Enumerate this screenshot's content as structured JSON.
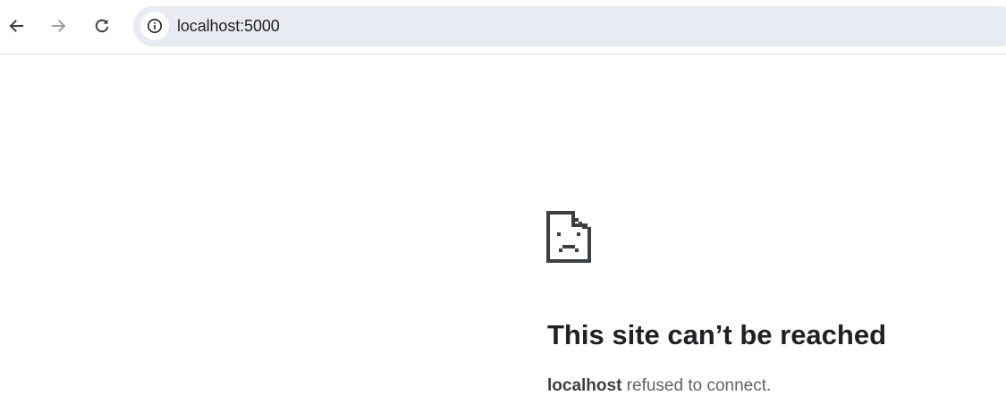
{
  "browser": {
    "nav": {
      "back_icon": "arrow-left-icon",
      "forward_icon": "arrow-right-icon",
      "reload_icon": "reload-icon"
    },
    "omnibox": {
      "info_icon": "info-icon",
      "url": "localhost:5000"
    }
  },
  "error_page": {
    "icon": "sad-document-icon",
    "title": "This site can’t be reached",
    "host": "localhost",
    "message": " refused to connect."
  },
  "colors": {
    "omnibox_bg": "#e9ebf3",
    "title_text": "#202124",
    "body_text": "#5f6368",
    "icon_disabled": "#9aa0a6"
  }
}
